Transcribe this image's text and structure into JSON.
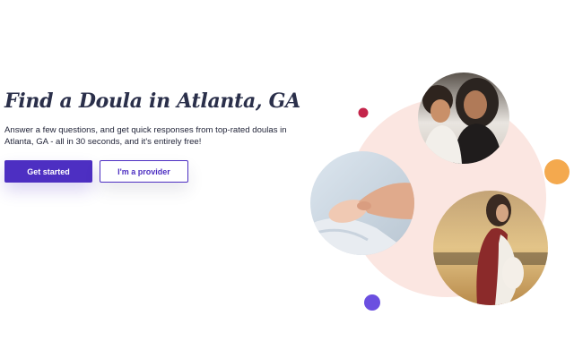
{
  "hero": {
    "title": "Find a Doula in Atlanta, GA",
    "subtitle": "Answer a few questions, and get quick responses from top-rated doulas in Atlanta, GA - all in 30 seconds, and it's entirely free!"
  },
  "actions": {
    "primary_label": "Get started",
    "secondary_label": "I'm a provider"
  },
  "colors": {
    "brand_purple": "#4d2fc2",
    "heading": "#2a2f4a",
    "blob_pink": "#fbe6e1",
    "dot_red": "#c4244a",
    "dot_orange": "#f4a94e",
    "dot_purple": "#6b4fe0"
  },
  "photos": [
    {
      "name": "mother-and-daughter-photo"
    },
    {
      "name": "baby-hand-photo"
    },
    {
      "name": "pregnant-woman-photo"
    }
  ]
}
